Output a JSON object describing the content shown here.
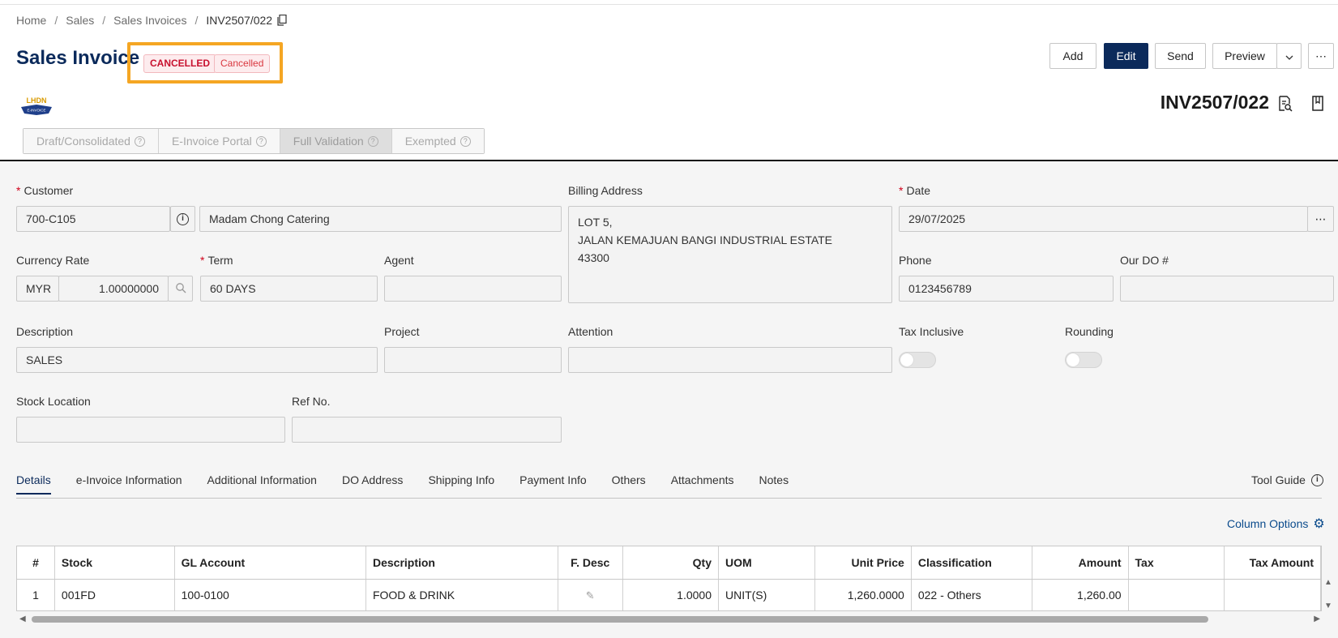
{
  "breadcrumb": {
    "items": [
      "Home",
      "Sales",
      "Sales Invoices"
    ],
    "separator": "/",
    "current": "INV2507/022"
  },
  "header": {
    "title": "Sales Invoice",
    "status_badge": "CANCELLED",
    "status_label": "Cancelled",
    "actions": {
      "add": "Add",
      "edit": "Edit",
      "send": "Send",
      "preview": "Preview",
      "more": "⋯"
    }
  },
  "document": {
    "number": "INV2507/022",
    "logo_text": "LHDN",
    "logo_subtext": "E-INVOICE"
  },
  "einvoice_modes": [
    "Draft/Consolidated",
    "E-Invoice Portal",
    "Full Validation",
    "Exempted"
  ],
  "einvoice_active": "Full Validation",
  "form": {
    "customer": {
      "label": "Customer",
      "code": "700-C105",
      "name": "Madam Chong Catering"
    },
    "billing_address": {
      "label": "Billing Address",
      "lines": [
        "LOT 5,",
        "JALAN KEMAJUAN BANGI INDUSTRIAL ESTATE",
        "43300"
      ]
    },
    "date": {
      "label": "Date",
      "value": "29/07/2025",
      "more": "⋯"
    },
    "currency_rate": {
      "label": "Currency Rate",
      "currency": "MYR",
      "rate": "1.00000000"
    },
    "term": {
      "label": "Term",
      "value": "60 DAYS"
    },
    "agent": {
      "label": "Agent",
      "value": ""
    },
    "phone": {
      "label": "Phone",
      "value": "0123456789"
    },
    "our_do": {
      "label": "Our DO #",
      "value": ""
    },
    "description": {
      "label": "Description",
      "value": "SALES"
    },
    "project": {
      "label": "Project",
      "value": ""
    },
    "attention": {
      "label": "Attention",
      "value": ""
    },
    "tax_inclusive": {
      "label": "Tax Inclusive",
      "on": false
    },
    "rounding": {
      "label": "Rounding",
      "on": false
    },
    "stock_location": {
      "label": "Stock Location",
      "value": ""
    },
    "ref_no": {
      "label": "Ref No.",
      "value": ""
    }
  },
  "tabs": [
    "Details",
    "e-Invoice Information",
    "Additional Information",
    "DO Address",
    "Shipping Info",
    "Payment Info",
    "Others",
    "Attachments",
    "Notes"
  ],
  "active_tab": "Details",
  "tool_guide": "Tool Guide",
  "column_options": "Column Options",
  "grid": {
    "columns": [
      "#",
      "Stock",
      "GL Account",
      "Description",
      "F. Desc",
      "Qty",
      "UOM",
      "Unit Price",
      "Classification",
      "Amount",
      "Tax",
      "Tax Amount"
    ],
    "rows": [
      {
        "no": "1",
        "stock": "001FD",
        "gl_account": "100-0100",
        "description": "FOOD & DRINK",
        "qty": "1.0000",
        "uom": "UNIT(S)",
        "unit_price": "1,260.0000",
        "classification": "022 - Others",
        "amount": "1,260.00",
        "tax": "",
        "tax_amount": ""
      }
    ]
  },
  "colors": {
    "brand_navy": "#0b2a5b",
    "highlight_box": "#f5a623",
    "cancelled_red": "#c8102e",
    "link_blue": "#0b4b8c"
  }
}
